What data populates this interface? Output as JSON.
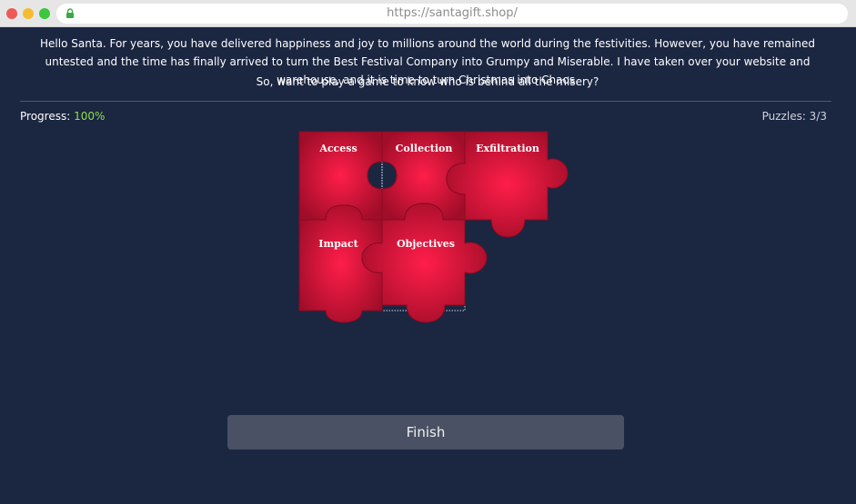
{
  "browser": {
    "url": "https://santagift.shop/"
  },
  "intro": {
    "paragraph": "Hello Santa. For years, you have delivered happiness and joy to millions around the world during the festivities. However, you have remained untested and the time has finally arrived to turn the Best Festival Company into Grumpy and Miserable. I have taken over your website and warehouse, and it is time to turn Christmas into Chaos.",
    "question": "So, want to play a game to know who is behind all the misery?"
  },
  "status": {
    "progress_label": "Progress:",
    "progress_value": "100%",
    "progress_fraction": 1.0,
    "puzzles": "Puzzles: 3/3"
  },
  "puzzle": {
    "pieces": [
      {
        "label": "Access"
      },
      {
        "label": "Collection"
      },
      {
        "label": "Exfiltration"
      },
      {
        "label": "Impact"
      },
      {
        "label": "Objectives"
      }
    ],
    "piece_color": "#c8102e",
    "piece_highlight": "#ff1e4a"
  },
  "actions": {
    "finish_label": "Finish"
  },
  "colors": {
    "background": "#1b2641",
    "progress_accent": "#8ee04a",
    "button": "#4a5164"
  }
}
